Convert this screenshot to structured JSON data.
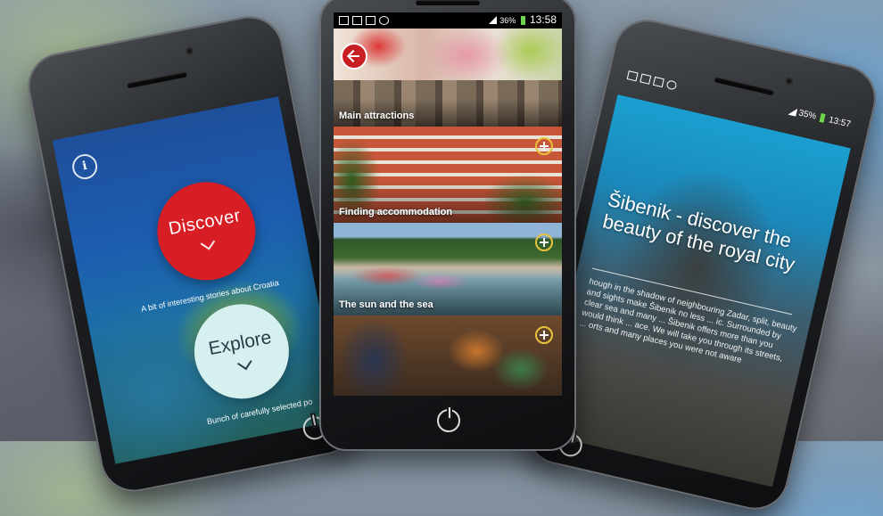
{
  "left_screen": {
    "discover_label": "Discover",
    "discover_subtitle": "A bit of interesting stories about Croatia",
    "explore_label": "Explore",
    "explore_subtitle": "Bunch of carefully selected po",
    "info_icon": "info-icon"
  },
  "center_screen": {
    "status": {
      "battery": "36%",
      "time": "13:58"
    },
    "cards": [
      {
        "label": "Main attractions",
        "icon": "none"
      },
      {
        "label": "Finding accommodation",
        "icon": "plus-icon"
      },
      {
        "label": "The sun and the sea",
        "icon": "plus-icon"
      },
      {
        "label": "",
        "icon": "plus-icon"
      }
    ],
    "back_icon": "back-arrow-icon"
  },
  "right_screen": {
    "status": {
      "battery": "35%",
      "time": "13:57"
    },
    "title": "Šibenik - discover the beauty of the royal city",
    "body": "hough in the shadow of neighbouring Zadar, split, beauty and sights make Šibenik no less ... ic. Surrounded by clear sea and many ... Šibenik offers more than you would think ... ace. We will take you through its streets, ... orts and many places you were not aware",
    "home_icon": "home-icon"
  },
  "colors": {
    "discover_red": "#d81e25",
    "explore_mint": "#d6efef",
    "accent_yellow": "#e8c23a",
    "battery_green": "#6ed34d"
  }
}
